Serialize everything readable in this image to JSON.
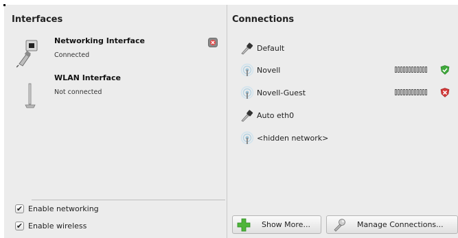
{
  "interfaces": {
    "heading": "Interfaces",
    "items": [
      {
        "title": "Networking Interface",
        "status": "Connected",
        "icon": "wired-network-icon",
        "action_icon": "disconnect-icon"
      },
      {
        "title": "WLAN Interface",
        "status": "Not connected",
        "icon": "wireless-antenna-icon"
      }
    ],
    "options": [
      {
        "label": "Enable networking",
        "checked": true
      },
      {
        "label": "Enable wireless",
        "checked": true
      }
    ]
  },
  "connections": {
    "heading": "Connections",
    "items": [
      {
        "label": "Default",
        "icon": "wired-plug-icon"
      },
      {
        "label": "Novell",
        "icon": "wireless-icon",
        "signal": "weak",
        "security": "secure"
      },
      {
        "label": "Novell-Guest",
        "icon": "wireless-icon",
        "signal": "weak",
        "security": "insecure"
      },
      {
        "label": "Auto eth0",
        "icon": "wired-plug-icon"
      },
      {
        "label": "<hidden network>",
        "icon": "wireless-icon"
      }
    ]
  },
  "buttons": {
    "show_more": "Show More...",
    "manage": "Manage Connections..."
  },
  "colors": {
    "secure": "#3fa93b",
    "insecure": "#d33a3a",
    "add": "#4fb53a",
    "pane_bg": "#ececec"
  }
}
